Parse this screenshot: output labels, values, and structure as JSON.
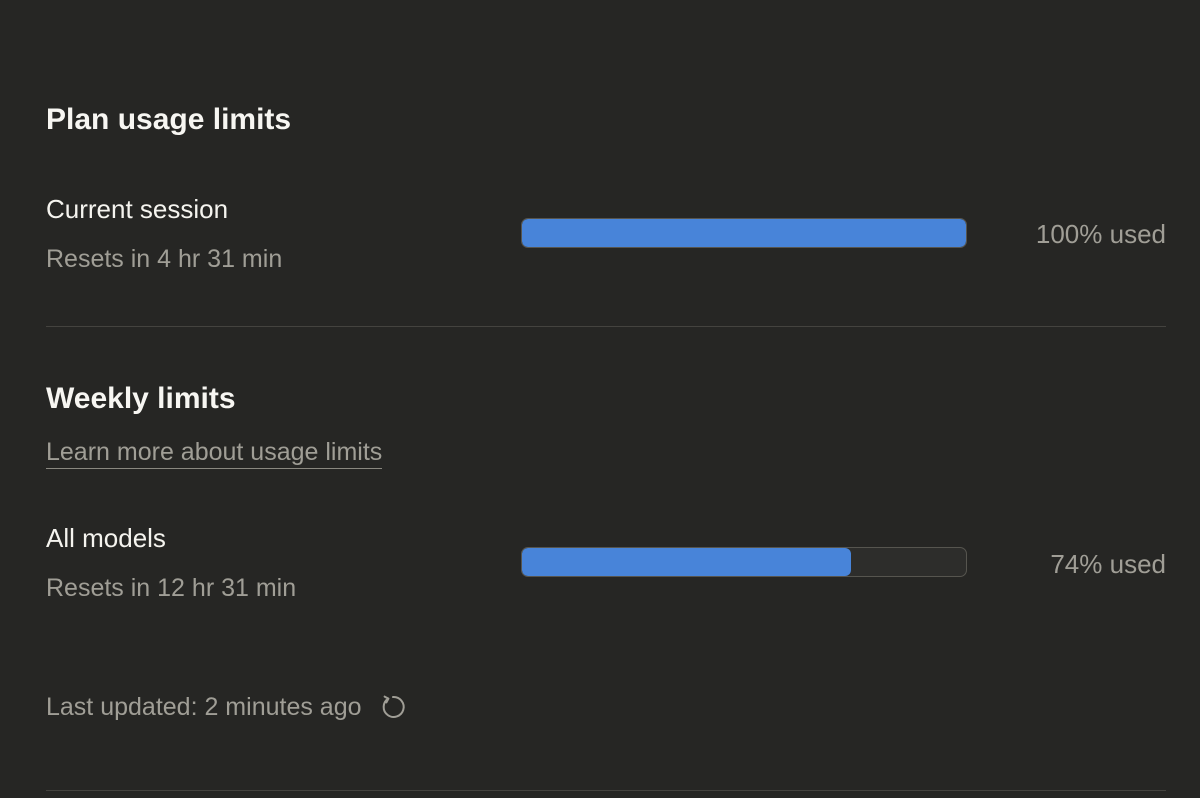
{
  "plan": {
    "title": "Plan usage limits",
    "session": {
      "label": "Current session",
      "resets": "Resets in 4 hr 31 min",
      "percent": 100,
      "usage_text": "100% used"
    }
  },
  "weekly": {
    "title": "Weekly limits",
    "learn_more": "Learn more about usage limits",
    "all_models": {
      "label": "All models",
      "resets": "Resets in 12 hr 31 min",
      "percent": 74,
      "usage_text": "74% used"
    }
  },
  "footer": {
    "last_updated": "Last updated: 2 minutes ago",
    "refresh_icon": "refresh-icon"
  },
  "colors": {
    "background": "#262624",
    "bar_fill": "#4884d9",
    "bar_track": "#2d2d2b",
    "muted_text": "#a09e96"
  }
}
